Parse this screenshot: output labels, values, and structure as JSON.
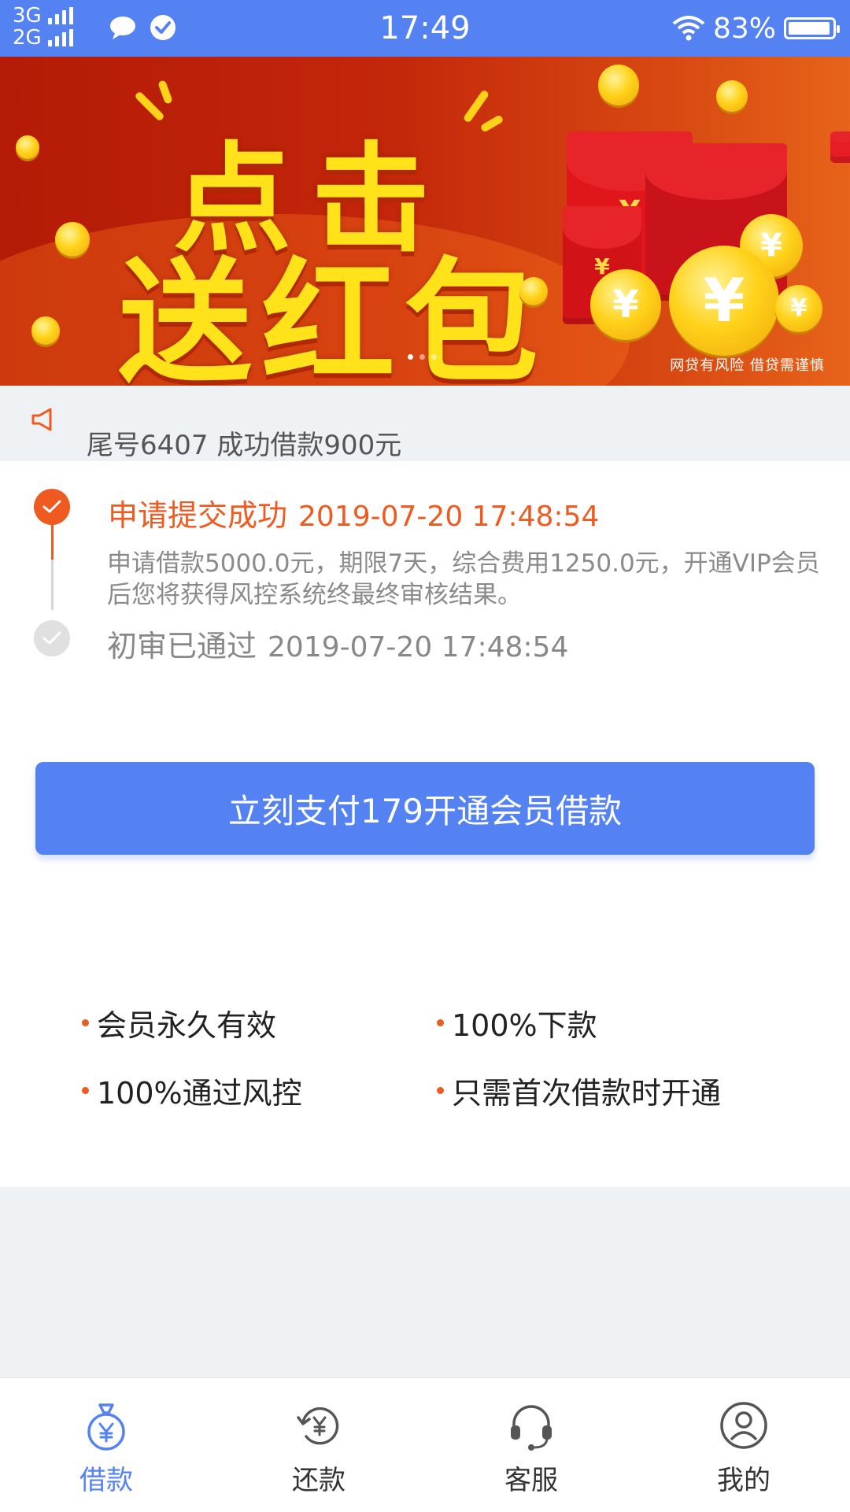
{
  "status_bar": {
    "net1": "3G",
    "net2": "2G",
    "time": "17:49",
    "battery": "83%",
    "icons": [
      "message-icon",
      "check-badge-icon",
      "wifi-icon",
      "battery-icon"
    ]
  },
  "banner": {
    "line1": "点击",
    "line2": "送红包",
    "risk": "网贷有风险  借贷需谨慎",
    "env_symbol": "¥",
    "dots": 3,
    "active_dot": 1
  },
  "notice": {
    "text": "尾号6407 成功借款900元"
  },
  "timeline": {
    "step1": {
      "title": "申请提交成功",
      "time": "2019-07-20 17:48:54",
      "desc": "申请借款5000.0元，期限7天，综合费用1250.0元，开通VIP会员后您将获得风控系统终最终审核结果。"
    },
    "step2": {
      "title": "初审已通过",
      "time": "2019-07-20 17:48:54"
    }
  },
  "pay_button": "立刻支付179开通会员借款",
  "features": [
    "会员永久有效",
    "100%下款",
    "100%通过风控",
    "只需首次借款时开通"
  ],
  "tabs": [
    {
      "label": "借款",
      "icon": "money-bag-icon"
    },
    {
      "label": "还款",
      "icon": "repay-icon"
    },
    {
      "label": "客服",
      "icon": "headset-icon"
    },
    {
      "label": "我的",
      "icon": "user-icon"
    }
  ],
  "colors": {
    "primary": "#5582f2",
    "accent": "#ef5a20",
    "banner_title": "#ffe21a"
  }
}
